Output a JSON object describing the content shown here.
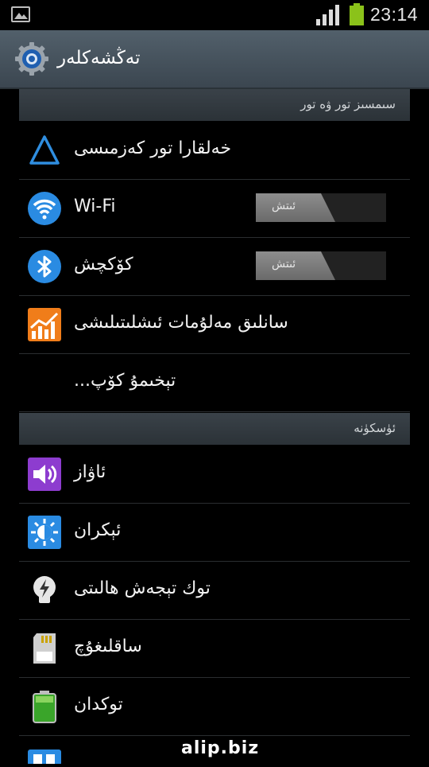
{
  "status_bar": {
    "time": "23:14"
  },
  "action_bar": {
    "title": "تەڭشەكلەر"
  },
  "sections": [
    {
      "header": "سىمسىز تور ۋە تور",
      "items": [
        {
          "label": "خەلقارا تور كەزمىسى",
          "icon": "triangle-network-icon"
        },
        {
          "label": "Wi-Fi",
          "icon": "wifi-icon",
          "toggle": "ئىتش"
        },
        {
          "label": "كۆكچش",
          "icon": "bluetooth-icon",
          "toggle": "ئىتش"
        },
        {
          "label": "سانلىق مەلۇمات ئىشلىتىلىشى",
          "icon": "data-usage-icon"
        },
        {
          "label": "تېخىمۇ كۆپ..."
        }
      ]
    },
    {
      "header": "ئۈسكۈنە",
      "items": [
        {
          "label": "ئاۋاز",
          "icon": "sound-icon"
        },
        {
          "label": "ئېكران",
          "icon": "display-icon"
        },
        {
          "label": "توك تېجەش ھالىتى",
          "icon": "power-saving-icon"
        },
        {
          "label": "ساقلىغۇچ",
          "icon": "storage-icon"
        },
        {
          "label": "توكدان",
          "icon": "battery-icon"
        }
      ]
    }
  ],
  "watermark": "alip.biz"
}
